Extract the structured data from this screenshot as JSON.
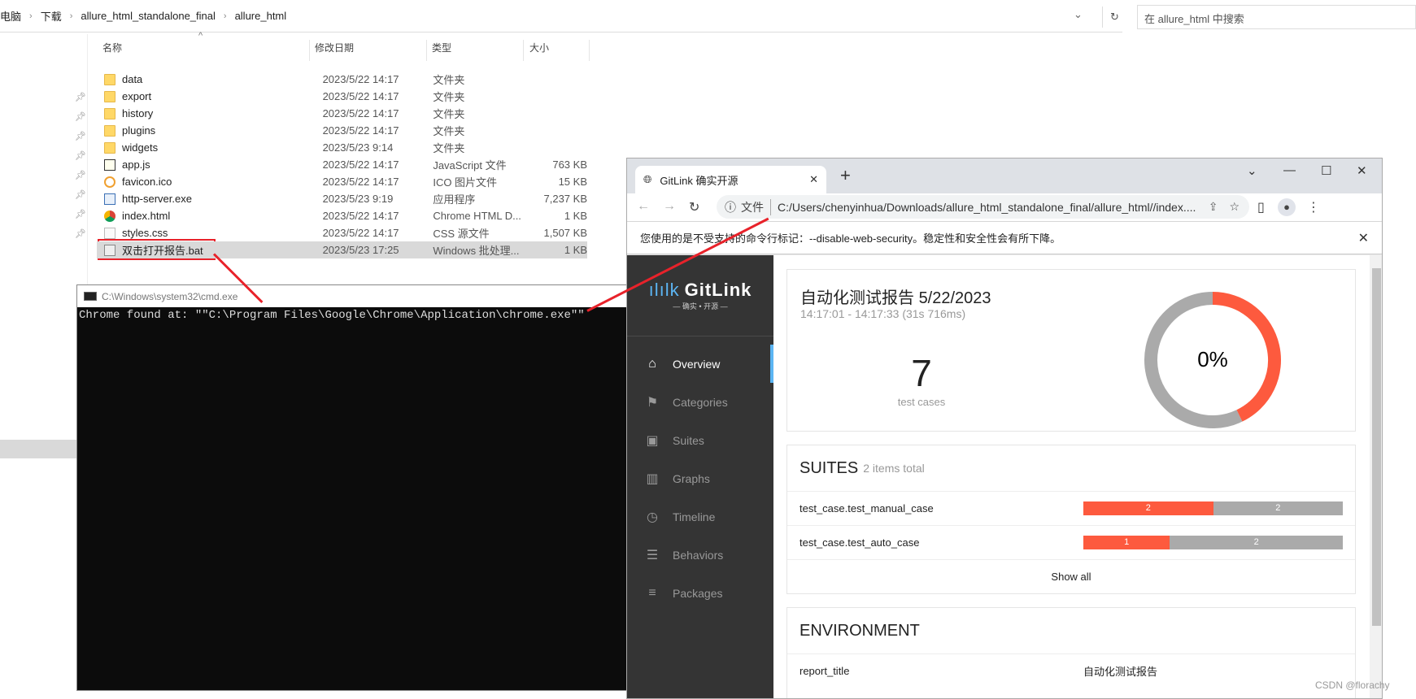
{
  "explorer": {
    "breadcrumb": [
      "电脑",
      "下载",
      "allure_html_standalone_final",
      "allure_html"
    ],
    "search_placeholder": "在 allure_html 中搜索",
    "columns": [
      "名称",
      "修改日期",
      "类型",
      "大小"
    ],
    "files": [
      {
        "name": "data",
        "date": "2023/5/22 14:17",
        "type": "文件夹",
        "size": "",
        "icon": "folder"
      },
      {
        "name": "export",
        "date": "2023/5/22 14:17",
        "type": "文件夹",
        "size": "",
        "icon": "folder"
      },
      {
        "name": "history",
        "date": "2023/5/22 14:17",
        "type": "文件夹",
        "size": "",
        "icon": "folder"
      },
      {
        "name": "plugins",
        "date": "2023/5/22 14:17",
        "type": "文件夹",
        "size": "",
        "icon": "folder"
      },
      {
        "name": "widgets",
        "date": "2023/5/23 9:14",
        "type": "文件夹",
        "size": "",
        "icon": "folder"
      },
      {
        "name": "app.js",
        "date": "2023/5/22 14:17",
        "type": "JavaScript 文件",
        "size": "763 KB",
        "icon": "js"
      },
      {
        "name": "favicon.ico",
        "date": "2023/5/22 14:17",
        "type": "ICO 图片文件",
        "size": "15 KB",
        "icon": "ico"
      },
      {
        "name": "http-server.exe",
        "date": "2023/5/23 9:19",
        "type": "应用程序",
        "size": "7,237 KB",
        "icon": "exe"
      },
      {
        "name": "index.html",
        "date": "2023/5/22 14:17",
        "type": "Chrome HTML D...",
        "size": "1 KB",
        "icon": "chrome"
      },
      {
        "name": "styles.css",
        "date": "2023/5/22 14:17",
        "type": "CSS 源文件",
        "size": "1,507 KB",
        "icon": "css"
      },
      {
        "name": "双击打开报告.bat",
        "date": "2023/5/23 17:25",
        "type": "Windows 批处理...",
        "size": "1 KB",
        "icon": "bat",
        "selected": true
      }
    ]
  },
  "cmd": {
    "title": "C:\\Windows\\system32\\cmd.exe",
    "output": "Chrome found at: \"\"C:\\Program Files\\Google\\Chrome\\Application\\chrome.exe\"\""
  },
  "browser": {
    "tab_title": "GitLink 确实开源",
    "chip": "文件",
    "url": "C:/Users/chenyinhua/Downloads/allure_html_standalone_final/allure_html//index....",
    "infobar": "您使用的是不受支持的命令行标记：--disable-web-security。稳定性和安全性会有所下降。"
  },
  "report": {
    "logo": "GitLink",
    "logo_sub": "— 确实 • 开源 —",
    "nav": [
      {
        "label": "Overview",
        "icon": "home",
        "active": true
      },
      {
        "label": "Categories",
        "icon": "flag"
      },
      {
        "label": "Suites",
        "icon": "briefcase"
      },
      {
        "label": "Graphs",
        "icon": "bar-chart"
      },
      {
        "label": "Timeline",
        "icon": "clock"
      },
      {
        "label": "Behaviors",
        "icon": "list"
      },
      {
        "label": "Packages",
        "icon": "align-left"
      }
    ],
    "title": "自动化测试报告",
    "date": "5/22/2023",
    "time": "14:17:01 - 14:17:33 (31s 716ms)",
    "count": "7",
    "count_label": "test cases",
    "percent": "0%",
    "donut": {
      "failed": 3,
      "unknown": 4,
      "colors": {
        "failed": "#fd5a3e",
        "unknown": "#aaaaaa"
      }
    },
    "suites_title": "SUITES",
    "suites_sub": "2 items total",
    "suites": [
      {
        "name": "test_case.test_manual_case",
        "failed": 2,
        "unknown": 2
      },
      {
        "name": "test_case.test_auto_case",
        "failed": 1,
        "unknown": 2
      }
    ],
    "show_all": "Show all",
    "env_title": "ENVIRONMENT",
    "env": [
      {
        "key": "report_title",
        "value": "自动化测试报告"
      }
    ]
  },
  "watermark": "CSDN @florachy"
}
